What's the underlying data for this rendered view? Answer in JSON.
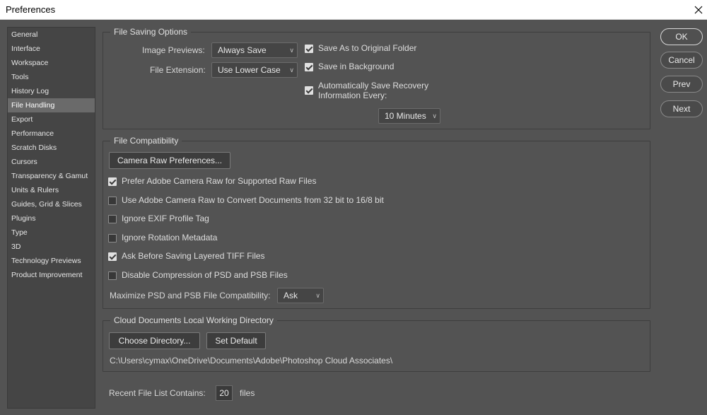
{
  "window": {
    "title": "Preferences",
    "close_glyph": "✕"
  },
  "sidebar": {
    "items": [
      {
        "label": "General"
      },
      {
        "label": "Interface"
      },
      {
        "label": "Workspace"
      },
      {
        "label": "Tools"
      },
      {
        "label": "History Log"
      },
      {
        "label": "File Handling",
        "selected": true
      },
      {
        "label": "Export"
      },
      {
        "label": "Performance"
      },
      {
        "label": "Scratch Disks"
      },
      {
        "label": "Cursors"
      },
      {
        "label": "Transparency & Gamut"
      },
      {
        "label": "Units & Rulers"
      },
      {
        "label": "Guides, Grid & Slices"
      },
      {
        "label": "Plugins"
      },
      {
        "label": "Type"
      },
      {
        "label": "3D"
      },
      {
        "label": "Technology Previews"
      },
      {
        "label": "Product Improvement"
      }
    ]
  },
  "file_saving": {
    "title": "File Saving Options",
    "image_previews_label": "Image Previews:",
    "image_previews_value": "Always Save",
    "file_extension_label": "File Extension:",
    "file_extension_value": "Use Lower Case",
    "save_as_original": {
      "label": "Save As to Original Folder",
      "checked": true
    },
    "save_in_background": {
      "label": "Save in Background",
      "checked": true
    },
    "auto_save": {
      "label_line1": "Automatically Save Recovery",
      "label_line2": "Information Every:",
      "checked": true
    },
    "auto_save_interval": "10 Minutes"
  },
  "file_compat": {
    "title": "File Compatibility",
    "camera_raw_button": "Camera Raw Preferences...",
    "options": [
      {
        "label": "Prefer Adobe Camera Raw for Supported Raw Files",
        "checked": true
      },
      {
        "label": "Use Adobe Camera Raw to Convert Documents from 32 bit to 16/8 bit",
        "checked": false
      },
      {
        "label": "Ignore EXIF Profile Tag",
        "checked": false
      },
      {
        "label": "Ignore Rotation Metadata",
        "checked": false
      },
      {
        "label": "Ask Before Saving Layered TIFF Files",
        "checked": true
      },
      {
        "label": "Disable Compression of PSD and PSB Files",
        "checked": false
      }
    ],
    "maximize_label": "Maximize PSD and PSB File Compatibility:",
    "maximize_value": "Ask"
  },
  "cloud": {
    "title": "Cloud Documents Local Working Directory",
    "choose_button": "Choose Directory...",
    "default_button": "Set Default",
    "path": "C:\\Users\\cymax\\OneDrive\\Documents\\Adobe\\Photoshop Cloud Associates\\"
  },
  "recent": {
    "label": "Recent File List Contains:",
    "value": "20",
    "suffix": "files"
  },
  "actions": {
    "ok": "OK",
    "cancel": "Cancel",
    "prev": "Prev",
    "next": "Next"
  },
  "icons": {
    "chevron": "chevron-down-icon",
    "check": "checkmark-icon",
    "close": "close-icon"
  }
}
